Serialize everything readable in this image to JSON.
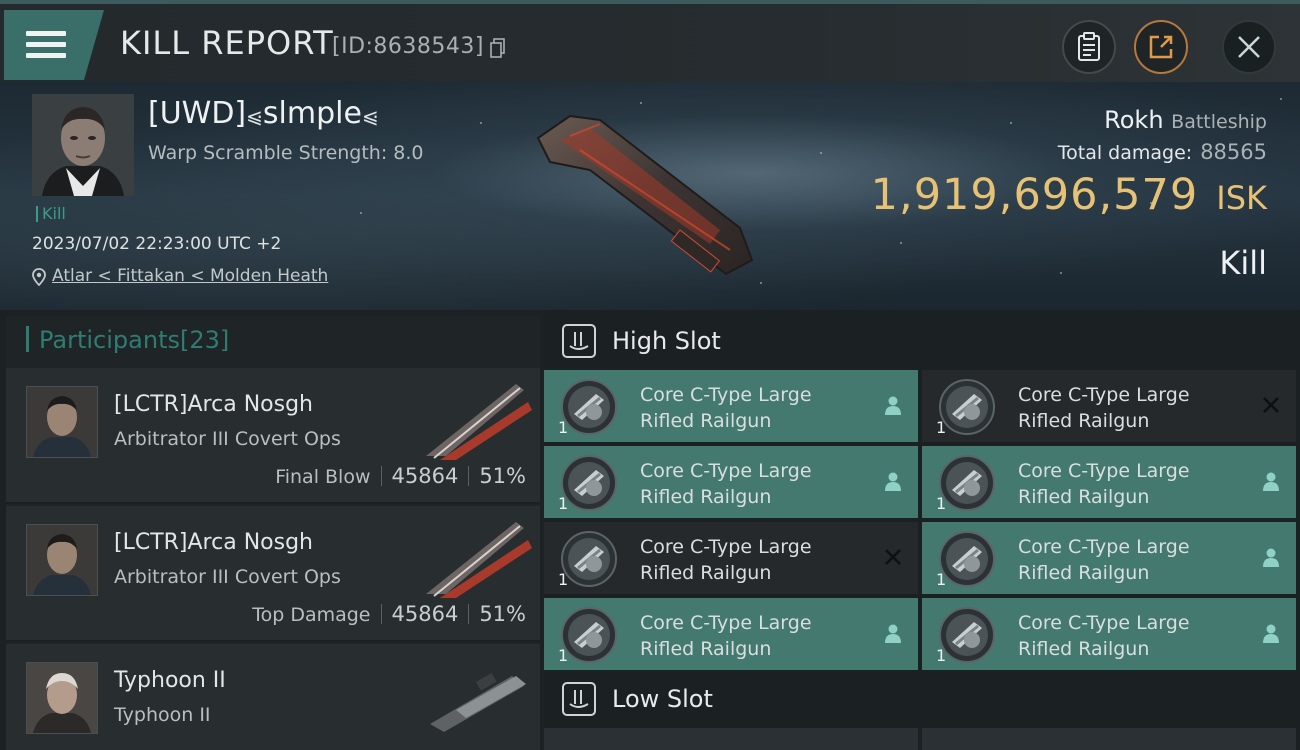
{
  "header": {
    "title": "KILL REPORT",
    "report_id": "[ID:8638543]",
    "buttons": [
      {
        "name": "clipboard-icon"
      },
      {
        "name": "share-icon"
      },
      {
        "name": "close-icon"
      }
    ]
  },
  "victim": {
    "name": "[UWD]",
    "name_suffix": "slmple",
    "warp_scramble": "Warp Scramble Strength: 8.0",
    "kill_tag": "Kill",
    "datetime": "2023/07/02 22:23:00 UTC +2",
    "location": "Atlar < Fittakan < Molden Heath",
    "ship_name": "Rokh",
    "ship_class": "Battleship",
    "total_damage_label": "Total damage:",
    "total_damage": "88565",
    "isk_value": "1,919,696,579",
    "isk_unit": "ISK",
    "result": "Kill"
  },
  "participants": {
    "title": "Participants",
    "count": "[23]",
    "list": [
      {
        "name": "[LCTR]Arca Nosgh",
        "ship": "Arbitrator III Covert Ops",
        "label": "Final Blow",
        "damage": "45864",
        "percent": "51%"
      },
      {
        "name": "[LCTR]Arca Nosgh",
        "ship": "Arbitrator III Covert Ops",
        "label": "Top Damage",
        "damage": "45864",
        "percent": "51%"
      },
      {
        "name": "Typhoon II",
        "ship": "Typhoon II",
        "label": "",
        "damage": "",
        "percent": ""
      }
    ]
  },
  "slots": {
    "high": {
      "title": "High Slot",
      "items": [
        {
          "line1": "Core C-Type Large",
          "line2": "Rifled Railgun",
          "qty": "1",
          "state": "fitted"
        },
        {
          "line1": "Core C-Type Large",
          "line2": "Rifled Railgun",
          "qty": "1",
          "state": "destroyed"
        },
        {
          "line1": "Core C-Type Large",
          "line2": "Rifled Railgun",
          "qty": "1",
          "state": "fitted"
        },
        {
          "line1": "Core C-Type Large",
          "line2": "Rifled Railgun",
          "qty": "1",
          "state": "fitted"
        },
        {
          "line1": "Core C-Type Large",
          "line2": "Rifled Railgun",
          "qty": "1",
          "state": "destroyed"
        },
        {
          "line1": "Core C-Type Large",
          "line2": "Rifled Railgun",
          "qty": "1",
          "state": "fitted"
        },
        {
          "line1": "Core C-Type Large",
          "line2": "Rifled Railgun",
          "qty": "1",
          "state": "fitted"
        },
        {
          "line1": "Core C-Type Large",
          "line2": "Rifled Railgun",
          "qty": "1",
          "state": "fitted"
        }
      ]
    },
    "low": {
      "title": "Low Slot"
    }
  },
  "colors": {
    "accent_teal": "#3b9c8c",
    "fitted_bg": "#43796f",
    "isk_gold": "#e6c277",
    "share_orange": "#b5793f"
  }
}
